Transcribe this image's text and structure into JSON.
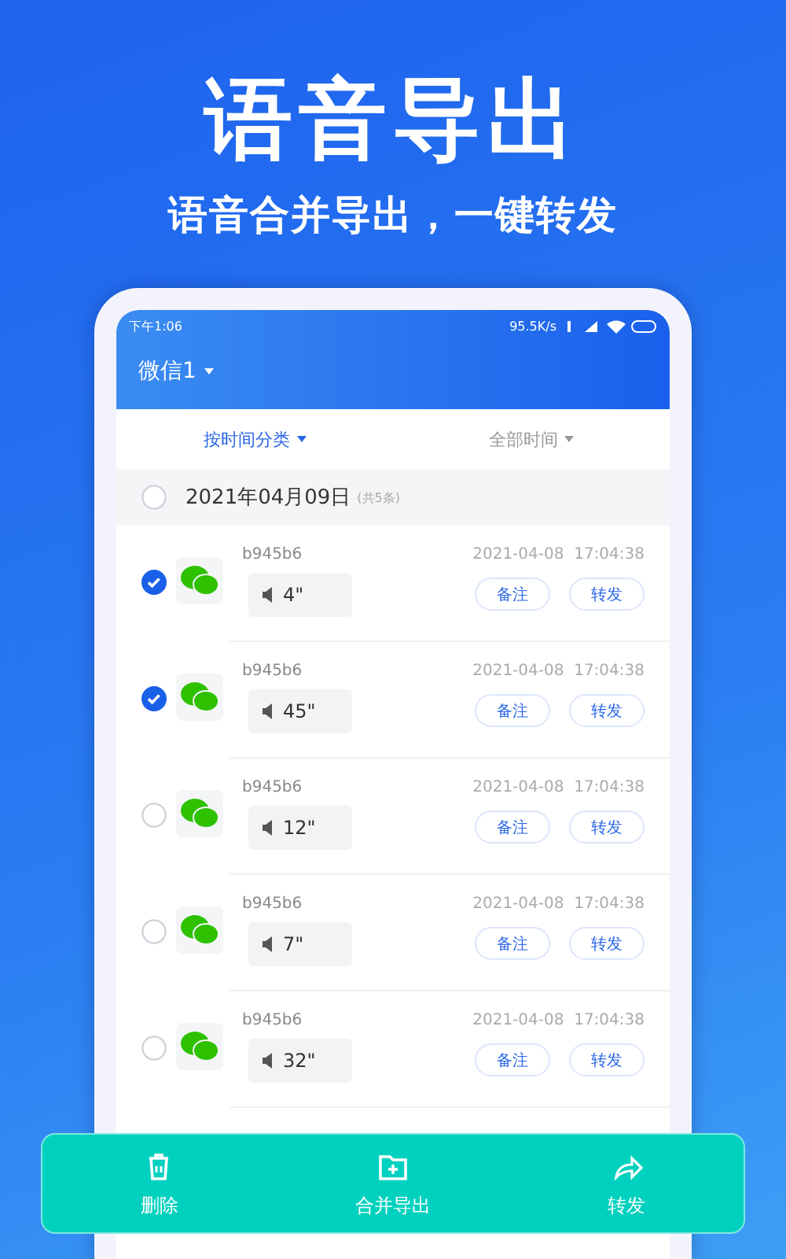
{
  "headline": "语音导出",
  "subtitle": "语音合并导出，一键转发",
  "status_bar": {
    "time": "下午1:06",
    "speed": "95.5K/s"
  },
  "account": {
    "label": "微信1"
  },
  "filters": [
    {
      "label": "按时间分类",
      "selected": true
    },
    {
      "label": "全部时间",
      "selected": false
    }
  ],
  "group": {
    "date": "2021年04月09日",
    "count": "(共5条)",
    "checked": false
  },
  "items": [
    {
      "checked": true,
      "name": "b945b6",
      "duration": "4\"",
      "time": "2021-04-08  17:04:38",
      "buttons": [
        "备注",
        "转发"
      ]
    },
    {
      "checked": true,
      "name": "b945b6",
      "duration": "45\"",
      "time": "2021-04-08  17:04:38",
      "buttons": [
        "备注",
        "转发"
      ]
    },
    {
      "checked": false,
      "name": "b945b6",
      "duration": "12\"",
      "time": "2021-04-08  17:04:38",
      "buttons": [
        "备注",
        "转发"
      ]
    },
    {
      "checked": false,
      "name": "b945b6",
      "duration": "7\"",
      "time": "2021-04-08  17:04:38",
      "buttons": [
        "备注",
        "转发"
      ]
    },
    {
      "checked": false,
      "name": "b945b6",
      "duration": "32\"",
      "time": "2021-04-08  17:04:38",
      "buttons": [
        "备注",
        "转发"
      ]
    }
  ],
  "actions": [
    {
      "kind": "delete",
      "label": "删除"
    },
    {
      "kind": "merge",
      "label": "合并导出"
    },
    {
      "kind": "forward",
      "label": "转发"
    }
  ]
}
